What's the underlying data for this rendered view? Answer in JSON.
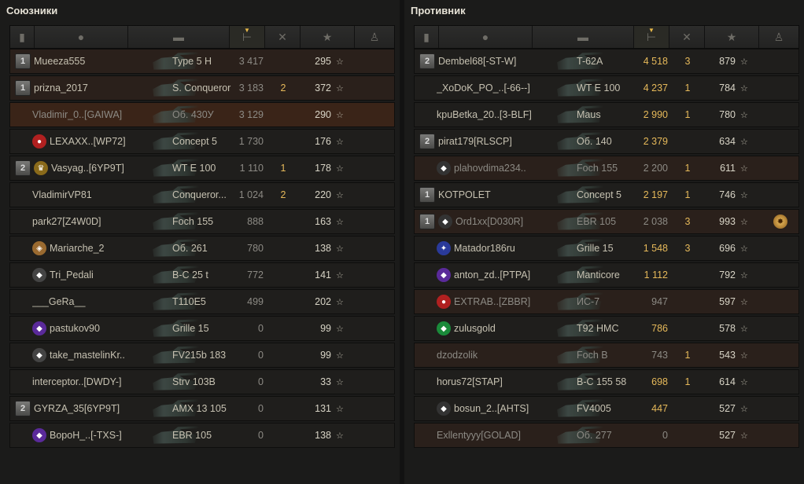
{
  "allies": {
    "title": "Союзники",
    "players": [
      {
        "platoon": "1",
        "emblem": "",
        "name": "Mueeza555",
        "vehicle": "Type 5 H",
        "damage": "3 417",
        "kills": "",
        "xp": "295",
        "row": "alt",
        "dim": false,
        "dmg_hi": false
      },
      {
        "platoon": "1",
        "emblem": "",
        "name": "prizna_2017",
        "vehicle": "S. Conqueror",
        "damage": "3 183",
        "kills": "2",
        "xp": "372",
        "row": "alt",
        "dim": false,
        "dmg_hi": false
      },
      {
        "platoon": "",
        "emblem": "",
        "name": "Vladimir_0..[GAIWA]",
        "vehicle": "Об. 430У",
        "damage": "3 129",
        "kills": "",
        "xp": "290",
        "row": "red",
        "dim": true,
        "dmg_hi": false
      },
      {
        "platoon": "",
        "emblem": "red",
        "name": "LEXAXX..[WP72]",
        "vehicle": "Concept 5",
        "damage": "1 730",
        "kills": "",
        "xp": "176",
        "row": "",
        "dim": false,
        "dmg_hi": false
      },
      {
        "platoon": "2",
        "emblem": "gold",
        "name": "Vasyag..[6YP9T]",
        "vehicle": "WT E 100",
        "damage": "1 110",
        "kills": "1",
        "xp": "178",
        "row": "",
        "dim": false,
        "dmg_hi": false
      },
      {
        "platoon": "",
        "emblem": "",
        "name": "VladimirVP81",
        "vehicle": "Conqueror...",
        "damage": "1 024",
        "kills": "2",
        "xp": "220",
        "row": "",
        "dim": false,
        "dmg_hi": false
      },
      {
        "platoon": "",
        "emblem": "",
        "name": "park27[Z4W0D]",
        "vehicle": "Foch 155",
        "damage": "888",
        "kills": "",
        "xp": "163",
        "row": "",
        "dim": false,
        "dmg_hi": false
      },
      {
        "platoon": "",
        "emblem": "shield",
        "name": "Mariarche_2",
        "vehicle": "Об. 261",
        "damage": "780",
        "kills": "",
        "xp": "138",
        "row": "",
        "dim": false,
        "dmg_hi": false
      },
      {
        "platoon": "",
        "emblem": "diamond1",
        "name": "Tri_Pedali",
        "vehicle": "B-C 25 t",
        "damage": "772",
        "kills": "",
        "xp": "141",
        "row": "",
        "dim": false,
        "dmg_hi": false
      },
      {
        "platoon": "",
        "emblem": "",
        "name": "___GeRa__",
        "vehicle": "T110E5",
        "damage": "499",
        "kills": "",
        "xp": "202",
        "row": "",
        "dim": false,
        "dmg_hi": false
      },
      {
        "platoon": "",
        "emblem": "purple",
        "name": "pastukov90",
        "vehicle": "Grille 15",
        "damage": "0",
        "kills": "",
        "xp": "99",
        "row": "",
        "dim": false,
        "dmg_hi": false
      },
      {
        "platoon": "",
        "emblem": "diamond2",
        "name": "take_mastelinKr..",
        "vehicle": "FV215b 183",
        "damage": "0",
        "kills": "",
        "xp": "99",
        "row": "",
        "dim": false,
        "dmg_hi": false
      },
      {
        "platoon": "",
        "emblem": "",
        "name": "interceptor..[DWDY-]",
        "vehicle": "Strv 103B",
        "damage": "0",
        "kills": "",
        "xp": "33",
        "row": "",
        "dim": false,
        "dmg_hi": false
      },
      {
        "platoon": "2",
        "emblem": "",
        "name": "GYRZA_35[6YP9T]",
        "vehicle": "AMX 13 105",
        "damage": "0",
        "kills": "",
        "xp": "131",
        "row": "",
        "dim": false,
        "dmg_hi": false
      },
      {
        "platoon": "",
        "emblem": "purple",
        "name": "BopoH_..[-TXS-]",
        "vehicle": "EBR 105",
        "damage": "0",
        "kills": "",
        "xp": "138",
        "row": "",
        "dim": false,
        "dmg_hi": false
      }
    ]
  },
  "enemies": {
    "title": "Противник",
    "players": [
      {
        "platoon": "2",
        "emblem": "",
        "name": "Dembel68[-ST-W]",
        "vehicle": "T-62A",
        "damage": "4 518",
        "kills": "3",
        "xp": "879",
        "row": "",
        "dim": false,
        "dmg_hi": true,
        "medal": ""
      },
      {
        "platoon": "",
        "emblem": "",
        "name": "_XoDoK_PO_..[-66--]",
        "vehicle": "WT E 100",
        "damage": "4 237",
        "kills": "1",
        "xp": "784",
        "row": "",
        "dim": false,
        "dmg_hi": true,
        "medal": ""
      },
      {
        "platoon": "",
        "emblem": "",
        "name": "kpuBetka_20..[3-BLF]",
        "vehicle": "Maus",
        "damage": "2 990",
        "kills": "1",
        "xp": "780",
        "row": "",
        "dim": false,
        "dmg_hi": true,
        "medal": ""
      },
      {
        "platoon": "2",
        "emblem": "",
        "name": "pirat179[RLSCP]",
        "vehicle": "Об. 140",
        "damage": "2 379",
        "kills": "",
        "xp": "634",
        "row": "",
        "dim": false,
        "dmg_hi": true,
        "medal": ""
      },
      {
        "platoon": "",
        "emblem": "diamond",
        "name": "plahovdima234..",
        "vehicle": "Foch 155",
        "damage": "2 200",
        "kills": "1",
        "xp": "611",
        "row": "alt",
        "dim": true,
        "dmg_hi": false,
        "medal": ""
      },
      {
        "platoon": "1",
        "emblem": "",
        "name": "KOTPOLET",
        "vehicle": "Concept 5",
        "damage": "2 197",
        "kills": "1",
        "xp": "746",
        "row": "",
        "dim": false,
        "dmg_hi": true,
        "medal": ""
      },
      {
        "platoon": "1",
        "emblem": "diamond",
        "name": "Ord1xx[D030R]",
        "vehicle": "EBR 105",
        "damage": "2 038",
        "kills": "3",
        "xp": "993",
        "row": "alt",
        "dim": true,
        "dmg_hi": false,
        "medal": "ace"
      },
      {
        "platoon": "",
        "emblem": "blue",
        "name": "Matador186ru",
        "vehicle": "Grille 15",
        "damage": "1 548",
        "kills": "3",
        "xp": "696",
        "row": "",
        "dim": false,
        "dmg_hi": true,
        "medal": ""
      },
      {
        "platoon": "",
        "emblem": "purple",
        "name": "anton_zd..[PTPA]",
        "vehicle": "Manticore",
        "damage": "1 112",
        "kills": "",
        "xp": "792",
        "row": "",
        "dim": false,
        "dmg_hi": true,
        "medal": ""
      },
      {
        "platoon": "",
        "emblem": "red",
        "name": "EXTRAB..[ZBBR]",
        "vehicle": "ИС-7",
        "damage": "947",
        "kills": "",
        "xp": "597",
        "row": "alt",
        "dim": true,
        "dmg_hi": false,
        "medal": ""
      },
      {
        "platoon": "",
        "emblem": "green",
        "name": "zulusgold",
        "vehicle": "T92 HMC",
        "damage": "786",
        "kills": "",
        "xp": "578",
        "row": "",
        "dim": false,
        "dmg_hi": true,
        "medal": ""
      },
      {
        "platoon": "",
        "emblem": "",
        "name": "dzodzolik",
        "vehicle": "Foch B",
        "damage": "743",
        "kills": "1",
        "xp": "543",
        "row": "alt",
        "dim": true,
        "dmg_hi": false,
        "medal": ""
      },
      {
        "platoon": "",
        "emblem": "",
        "name": "horus72[STAP]",
        "vehicle": "B-C 155 58",
        "damage": "698",
        "kills": "1",
        "xp": "614",
        "row": "",
        "dim": false,
        "dmg_hi": true,
        "medal": ""
      },
      {
        "platoon": "",
        "emblem": "diamond",
        "name": "bosun_2..[AHTS]",
        "vehicle": "FV4005",
        "damage": "447",
        "kills": "",
        "xp": "527",
        "row": "",
        "dim": false,
        "dmg_hi": true,
        "medal": ""
      },
      {
        "platoon": "",
        "emblem": "",
        "name": "Exllentyyy[GOLAD]",
        "vehicle": "Об. 277",
        "damage": "0",
        "kills": "",
        "xp": "527",
        "row": "alt",
        "dim": true,
        "dmg_hi": false,
        "medal": ""
      }
    ]
  },
  "columns": [
    "platoon-icon",
    "player-icon",
    "vehicle-icon",
    "damage-icon",
    "kills-icon",
    "xp-star-icon",
    "medal-icon"
  ],
  "star_glyph": "☆",
  "sorted_column": "damage"
}
